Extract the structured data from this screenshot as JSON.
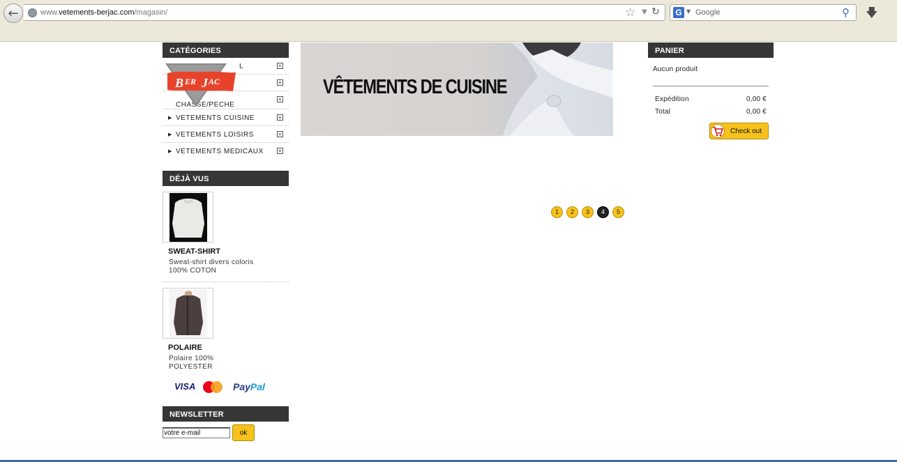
{
  "browser": {
    "url_prefix": "www.",
    "url_domain": "vetements-berjac.com",
    "url_path": "/magasin/",
    "search_placeholder": "Google",
    "search_engine_icon": "G"
  },
  "sidebar": {
    "categories_title": "CATÉGORIES",
    "categories": [
      {
        "label": "L"
      },
      {
        "label": ""
      },
      {
        "label": "CHASSE/PECHE"
      },
      {
        "label": "VETEMENTS CUISINE"
      },
      {
        "label": "VETEMENTS LOISIRS"
      },
      {
        "label": "VETEMENTS MEDICAUX"
      }
    ],
    "logo_text": "BERJAC",
    "viewed_title": "DÉJÀ VUS",
    "viewed": [
      {
        "name": "SWEAT-SHIRT",
        "desc": "Sweat-shirt divers coloris 100% COTON"
      },
      {
        "name": "POLAIRE",
        "desc": "Polaire 100% POLYESTER"
      }
    ],
    "payment": {
      "visa": "VISA",
      "paypal_a": "Pay",
      "paypal_b": "Pal"
    },
    "newsletter_title": "NEWSLETTER",
    "newsletter_value": "votre e-mail",
    "newsletter_button": "ok"
  },
  "main": {
    "banner_text": "VÊTEMENTS DE CUISINE",
    "pages": [
      "1",
      "2",
      "3",
      "4",
      "5"
    ],
    "active_page": "4"
  },
  "cart": {
    "title": "PANIER",
    "empty_text": "Aucun produit",
    "shipping_label": "Expédition",
    "shipping_value": "0,00 €",
    "total_label": "Total",
    "total_value": "0,00 €",
    "checkout_label": "Check out"
  }
}
